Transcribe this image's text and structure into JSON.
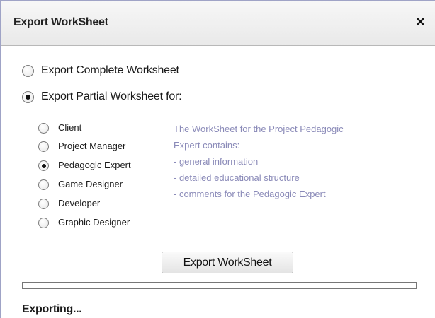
{
  "dialog": {
    "title": "Export WorkSheet",
    "close_symbol": "×",
    "close_icon": "close-icon"
  },
  "options": {
    "complete_label": "Export Complete Worksheet",
    "partial_label": "Export Partial Worksheet for:",
    "selected": "partial"
  },
  "roles": {
    "items": [
      {
        "label": "Client",
        "checked": false
      },
      {
        "label": "Project Manager",
        "checked": false
      },
      {
        "label": "Pedagogic Expert",
        "checked": true
      },
      {
        "label": "Game Designer",
        "checked": false
      },
      {
        "label": "Developer",
        "checked": false
      },
      {
        "label": "Graphic Designer",
        "checked": false
      }
    ]
  },
  "description": {
    "lines": [
      "The WorkSheet for the Project Pedagogic",
      "Expert contains:",
      "- general information",
      "- detailed educational structure",
      "- comments for the Pedagogic Expert"
    ],
    "color": "#8a8ab8"
  },
  "export_button": {
    "label": "Export WorkSheet"
  },
  "progress": {
    "value": 0
  },
  "status": {
    "text": "Exporting..."
  }
}
